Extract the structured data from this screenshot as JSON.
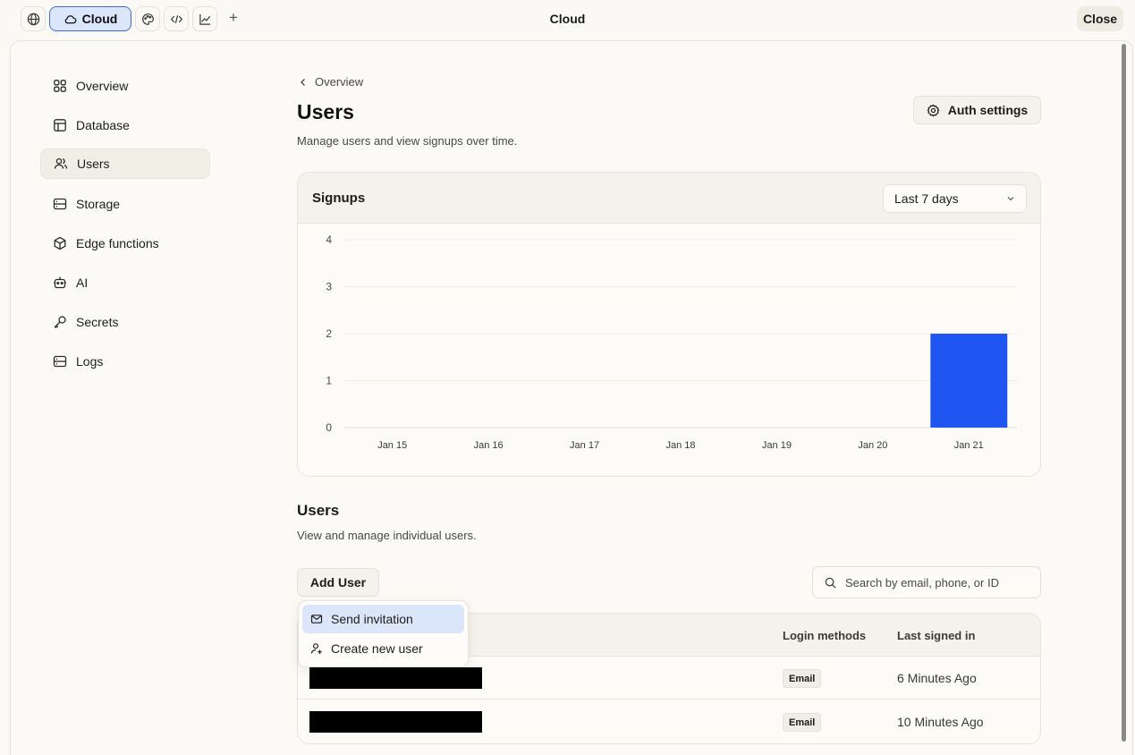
{
  "topbar": {
    "cloud_label": "Cloud",
    "title": "Cloud",
    "close_label": "Close",
    "plus_label": "+"
  },
  "sidebar": {
    "items": [
      {
        "label": "Overview",
        "icon": "grid-icon"
      },
      {
        "label": "Database",
        "icon": "table-icon"
      },
      {
        "label": "Users",
        "icon": "users-icon",
        "active": true
      },
      {
        "label": "Storage",
        "icon": "storage-icon"
      },
      {
        "label": "Edge functions",
        "icon": "cube-icon"
      },
      {
        "label": "AI",
        "icon": "robot-icon"
      },
      {
        "label": "Secrets",
        "icon": "key-icon"
      },
      {
        "label": "Logs",
        "icon": "logs-icon"
      }
    ]
  },
  "main": {
    "breadcrumb": "Overview",
    "title": "Users",
    "subtitle": "Manage users and view signups over time.",
    "auth_settings_label": "Auth settings"
  },
  "chart_card": {
    "title": "Signups",
    "range": "Last 7 days"
  },
  "chart_data": {
    "type": "bar",
    "title": "Signups",
    "categories": [
      "Jan 15",
      "Jan 16",
      "Jan 17",
      "Jan 18",
      "Jan 19",
      "Jan 20",
      "Jan 21"
    ],
    "values": [
      0,
      0,
      0,
      0,
      0,
      0,
      2
    ],
    "ylim": [
      0,
      4
    ],
    "yticks": [
      0,
      1,
      2,
      3,
      4
    ],
    "xlabel": "",
    "ylabel": "",
    "grid": true,
    "bar_color": "#1f55f0"
  },
  "users_section": {
    "title": "Users",
    "subtitle": "View and manage individual users.",
    "add_user_label": "Add User",
    "search_placeholder": "Search by email, phone, or ID"
  },
  "dropdown": {
    "items": [
      {
        "label": "Send invitation",
        "icon": "mail-icon"
      },
      {
        "label": "Create new user",
        "icon": "user-plus-icon"
      }
    ]
  },
  "table": {
    "columns": [
      "Login methods",
      "Last signed in"
    ],
    "rows": [
      {
        "method": "Email",
        "last_signed_in": "6 Minutes Ago"
      },
      {
        "method": "Email",
        "last_signed_in": "10 Minutes Ago"
      }
    ]
  },
  "colors": {
    "accent": "#3b6ee6",
    "accent_bg": "#dbe6fb",
    "bar": "#1f55f0"
  }
}
